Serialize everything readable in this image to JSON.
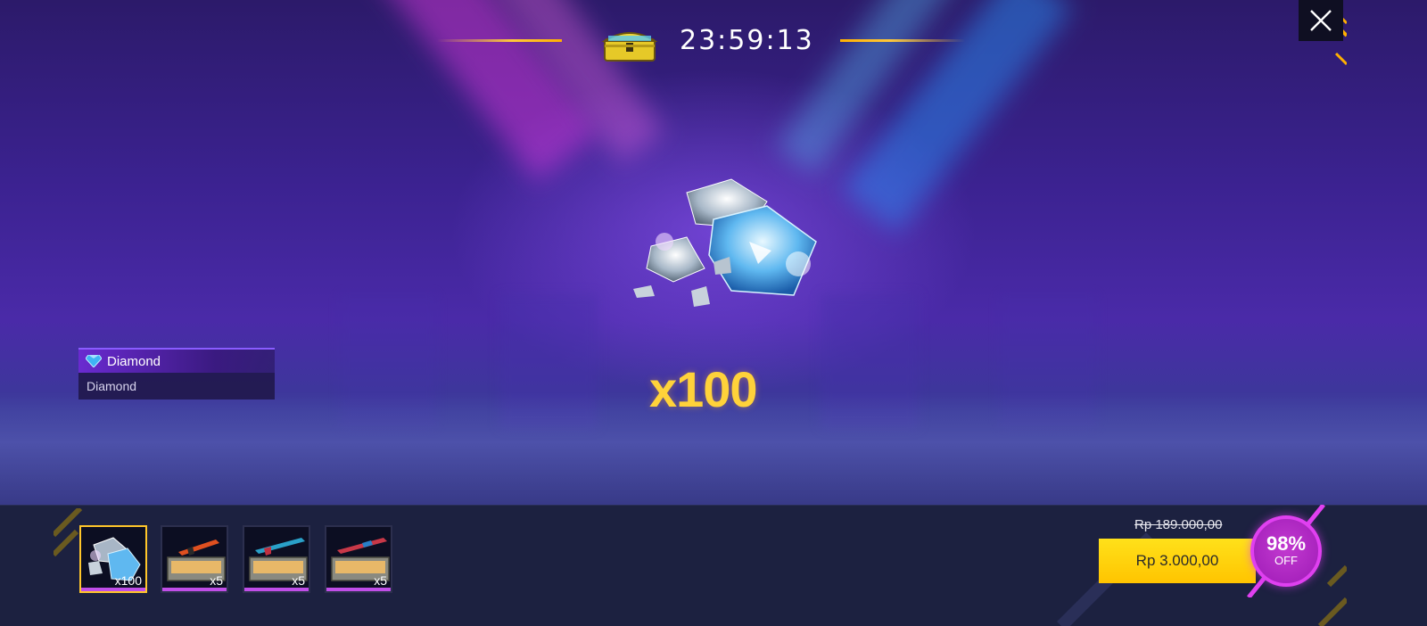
{
  "header": {
    "timer": "23:59:13"
  },
  "reward": {
    "name": "Diamond",
    "description": "Diamond",
    "quantity": "x100"
  },
  "items": [
    {
      "qty": "x100",
      "icon": "diamond-pile-icon"
    },
    {
      "qty": "x5",
      "icon": "weapon-crate-icon"
    },
    {
      "qty": "x5",
      "icon": "weapon-crate-icon"
    },
    {
      "qty": "x5",
      "icon": "weapon-crate-icon"
    }
  ],
  "purchase": {
    "old_price": "Rp 189.000,00",
    "price": "Rp 3.000,00",
    "discount_pct": "98%",
    "discount_label": "OFF"
  },
  "colors": {
    "accent_yellow": "#ffc400",
    "badge_magenta": "#c23ad0",
    "quantity_gold": "#ffd23a"
  }
}
